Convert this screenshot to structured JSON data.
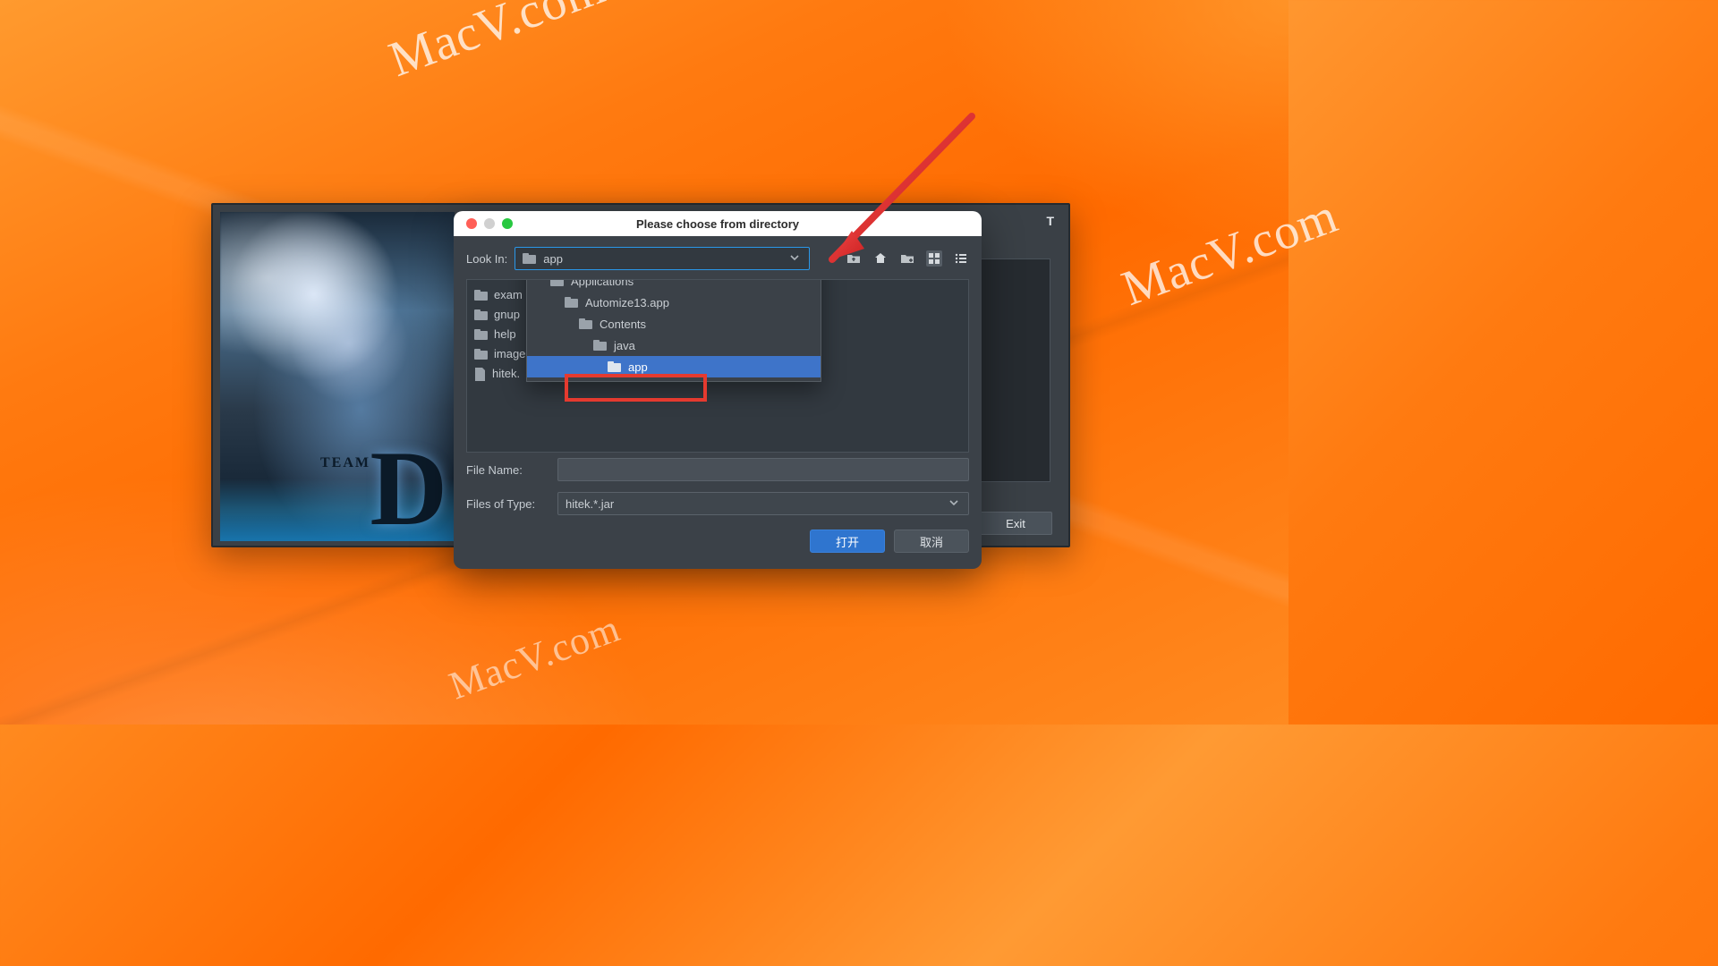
{
  "watermark": "MacV.com",
  "back_window": {
    "exit": "Exit",
    "title_suffix": "T"
  },
  "dialog": {
    "title": "Please choose from directory",
    "look_in_label": "Look In:",
    "look_in_value": "app",
    "folder_popup": [
      {
        "label": "/",
        "indent": 0,
        "selected": false
      },
      {
        "label": "Applications",
        "indent": 1,
        "selected": false
      },
      {
        "label": "Automize13.app",
        "indent": 2,
        "selected": false
      },
      {
        "label": "Contents",
        "indent": 3,
        "selected": false
      },
      {
        "label": "java",
        "indent": 4,
        "selected": false
      },
      {
        "label": "app",
        "indent": 5,
        "selected": true
      }
    ],
    "left_items": [
      "exam",
      "gnup",
      "help",
      "image",
      "hitek."
    ],
    "file_name_label": "File Name:",
    "file_name_value": "",
    "files_of_type_label": "Files of Type:",
    "files_of_type_value": "hitek.*.jar",
    "open": "打开",
    "cancel": "取消",
    "toolbar_icons": {
      "up": "folder-up-icon",
      "home": "home-icon",
      "new_folder": "new-folder-icon",
      "grid_view": "grid-view-icon",
      "list_view": "list-view-icon"
    }
  }
}
